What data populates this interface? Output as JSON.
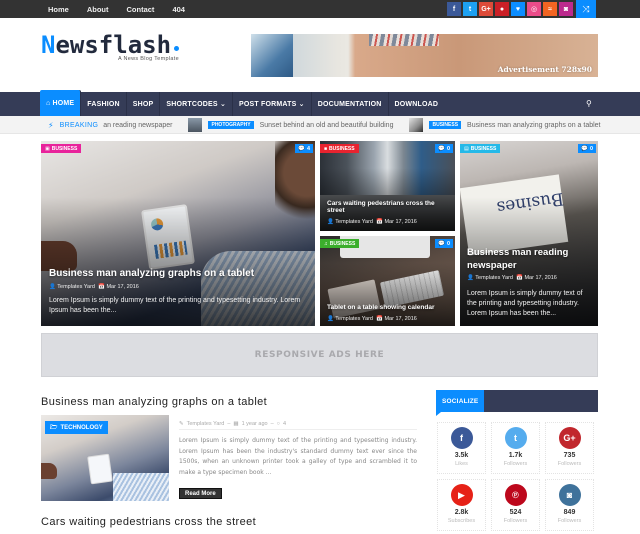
{
  "colors": {
    "accent": "#0b8dff",
    "nav_bg": "#353c57",
    "topbar_bg": "#333333"
  },
  "topbar": {
    "links": [
      "Home",
      "About",
      "Contact",
      "404"
    ],
    "social_icons": [
      {
        "name": "facebook-icon",
        "glyph": "f",
        "color": "#3b5998"
      },
      {
        "name": "twitter-icon",
        "glyph": "t",
        "color": "#1da1f2"
      },
      {
        "name": "google-plus-icon",
        "glyph": "G+",
        "color": "#dd4b39"
      },
      {
        "name": "pinterest-icon",
        "glyph": "●",
        "color": "#cb2027"
      },
      {
        "name": "bloglovin-icon",
        "glyph": "♥",
        "color": "#0b8dff"
      },
      {
        "name": "dribbble-icon",
        "glyph": "◎",
        "color": "#ea4c89"
      },
      {
        "name": "rss-icon",
        "glyph": "≈",
        "color": "#f26522"
      },
      {
        "name": "instagram-icon",
        "glyph": "◙",
        "color": "#bc2a8d"
      }
    ],
    "shuffle_glyph": "⤨"
  },
  "header": {
    "logo_first": "N",
    "logo_rest": "ewsflash",
    "tagline": "A News Blog Template",
    "ad_label": "Advertisement 728x90"
  },
  "nav": {
    "home_icon": "⌂",
    "items": [
      {
        "label": "HOME",
        "active": true
      },
      {
        "label": "FASHION"
      },
      {
        "label": "SHOP"
      },
      {
        "label": "SHORTCODES ⌄"
      },
      {
        "label": "POST FORMATS ⌄"
      },
      {
        "label": "DOCUMENTATION"
      },
      {
        "label": "DOWNLOAD"
      }
    ],
    "search_glyph": "⚲"
  },
  "ticker": {
    "label": "BREAKING",
    "bolt_glyph": "⚡",
    "entries": [
      {
        "text": "an reading newspaper"
      },
      {
        "category": "PHOTOGRAPHY",
        "text": "Sunset behind an old and beautiful building"
      },
      {
        "category": "BUSINESS",
        "text": "Business man analyzing graphs on a tablet"
      }
    ]
  },
  "featured": [
    {
      "category": "BUSINESS",
      "category_color": "#e8239b",
      "comments": "4",
      "title": "Business man analyzing graphs on a tablet",
      "author": "Templates Yard",
      "date": "Mar 17, 2016",
      "excerpt": "Lorem Ipsum is simply dummy text of the printing and typesetting industry. Lorem Ipsum has been the..."
    },
    {
      "category": "BUSINESS",
      "category_color": "#e8232f",
      "comments": "0",
      "title": "Cars waiting pedestrians cross the street",
      "author": "Templates Yard",
      "date": "Mar 17, 2016"
    },
    {
      "category": "BUSINESS",
      "category_color": "#3bae2c",
      "comments": "0",
      "title": "Tablet on a table showing calendar",
      "author": "Templates Yard",
      "date": "Mar 17, 2016"
    },
    {
      "category": "BUSINESS",
      "category_color": "#25b9e8",
      "comments": "0",
      "title": "Business man reading newspaper",
      "author": "Templates Yard",
      "date": "Mar 17, 2016",
      "excerpt": "Lorem Ipsum is simply dummy text of the printing and typesetting industry. Lorem Ipsum has been the..."
    }
  ],
  "responsive_ad": "RESPONSIVE ADS HERE",
  "posts": [
    {
      "title": "Business man analyzing graphs on a tablet",
      "category": "TECHNOLOGY",
      "author": "Templates Yard",
      "time": "1 year ago",
      "comments": "4",
      "excerpt": "Lorem Ipsum is simply dummy text of the printing and typesetting industry. Lorem Ipsum has been the industry's standard dummy text ever since the 1500s, when an unknown printer took a galley of type and scrambled it to make a type specimen book ...",
      "read_more": "Read More"
    },
    {
      "title": "Cars waiting pedestrians cross the street"
    }
  ],
  "sidebar": {
    "title": "SOCIALIZE",
    "counters": [
      {
        "network": "facebook",
        "glyph": "f",
        "color": "#3b5998",
        "count": "3.5k",
        "label": "Likes"
      },
      {
        "network": "twitter",
        "glyph": "t",
        "color": "#55acee",
        "count": "1.7k",
        "label": "Followers"
      },
      {
        "network": "google-plus",
        "glyph": "G+",
        "color": "#c1272d",
        "count": "735",
        "label": "Followers"
      },
      {
        "network": "youtube",
        "glyph": "▶",
        "color": "#e62117",
        "count": "2.8k",
        "label": "Subscribes"
      },
      {
        "network": "pinterest",
        "glyph": "℗",
        "color": "#bd081c",
        "count": "524",
        "label": "Followers"
      },
      {
        "network": "instagram",
        "glyph": "◙",
        "color": "#3f729b",
        "count": "849",
        "label": "Followers"
      }
    ]
  }
}
